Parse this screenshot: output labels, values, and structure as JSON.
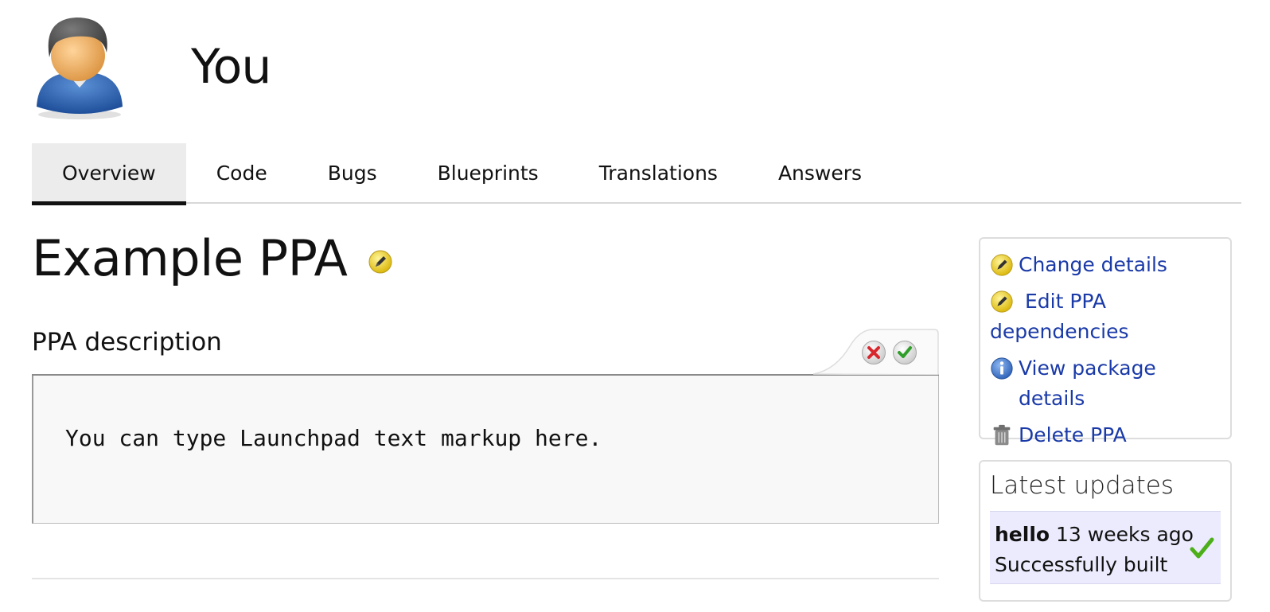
{
  "header": {
    "owner": "You",
    "avatar_icon": "user-avatar-icon"
  },
  "tabs": [
    {
      "label": "Overview",
      "active": true
    },
    {
      "label": "Code",
      "active": false
    },
    {
      "label": "Bugs",
      "active": false
    },
    {
      "label": "Blueprints",
      "active": false
    },
    {
      "label": "Translations",
      "active": false
    },
    {
      "label": "Answers",
      "active": false
    }
  ],
  "main": {
    "title": "Example PPA",
    "title_edit_icon": "edit-pencil-icon",
    "description_label": "PPA description",
    "description_placeholder": "You can type Launchpad text markup here.",
    "cancel_icon": "cancel-x-icon",
    "save_icon": "save-check-icon"
  },
  "actions": {
    "change_details": "Change details",
    "edit_dependencies_line1": "Edit PPA",
    "edit_dependencies_line2": "dependencies",
    "view_package_details": "View package details",
    "delete_ppa": "Delete PPA"
  },
  "updates": {
    "title": "Latest updates",
    "items": [
      {
        "name": "hello",
        "time": "13 weeks ago",
        "status": "Successfully built",
        "status_icon": "success-check-icon"
      }
    ]
  },
  "colors": {
    "link": "#1a3aa8",
    "active_tab_bg": "#ececec",
    "update_bg": "#ebebfd",
    "success": "#4caf1a"
  }
}
